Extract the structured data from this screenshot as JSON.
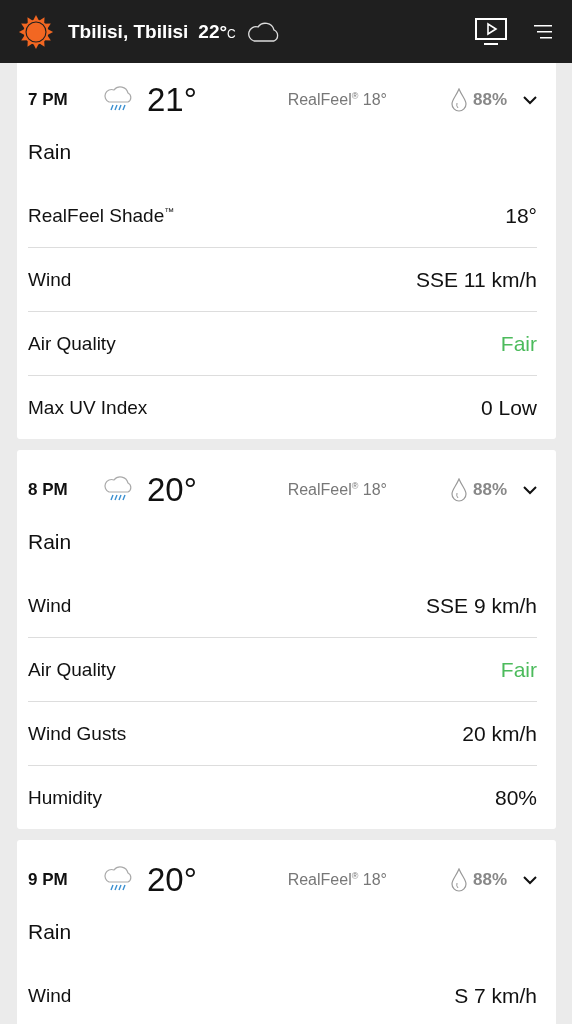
{
  "header": {
    "location": "Tbilisi, Tbilisi",
    "temperature": "22°$_{C}$"
  },
  "hours": [
    {
      "time": "7 PM",
      "temperature": "21°",
      "realfeel": "RealFeel$^{®}$ 18°",
      "precipitation": "88%",
      "condition": "Rain",
      "details": [
        {
          "label": "RealFeel Shade$^{™}$",
          "value": "18°"
        },
        {
          "label": "Wind",
          "value": "SSE 11 km/h"
        },
        {
          "label": "Air Quality",
          "value": "Fair",
          "color": "#4cbb5c"
        },
        {
          "label": "Max UV Index",
          "value": "0 Low"
        }
      ]
    },
    {
      "time": "8 PM",
      "temperature": "20°",
      "realfeel": "RealFeel$^{®}$ 18°",
      "precipitation": "88%",
      "condition": "Rain",
      "details": [
        {
          "label": "Wind",
          "value": "SSE 9 km/h"
        },
        {
          "label": "Air Quality",
          "value": "Fair",
          "color": "#4cbb5c"
        },
        {
          "label": "Wind Gusts",
          "value": "20 km/h"
        },
        {
          "label": "Humidity",
          "value": "80%"
        }
      ]
    },
    {
      "time": "9 PM",
      "temperature": "20°",
      "realfeel": "RealFeel$^{®}$ 18°",
      "precipitation": "88%",
      "condition": "Rain",
      "details": [
        {
          "label": "Wind",
          "value": "S 7 km/h"
        }
      ]
    }
  ]
}
